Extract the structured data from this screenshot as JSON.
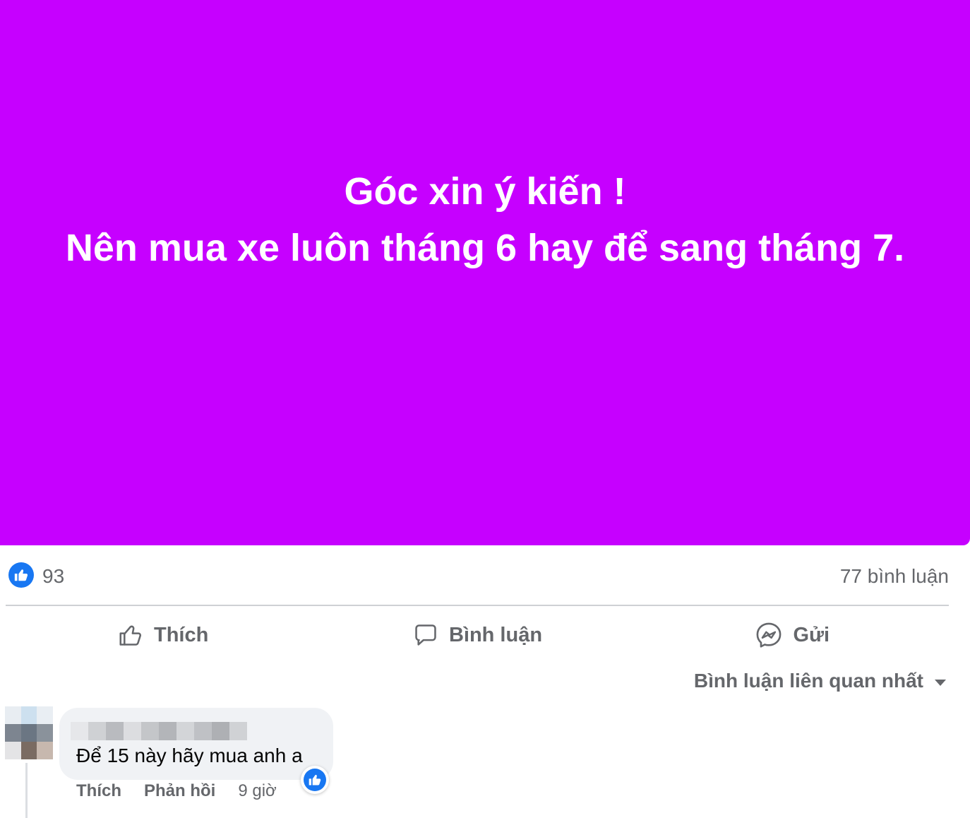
{
  "colors": {
    "banner_bg": "#c600ff",
    "like_blue": "#1877f2",
    "secondary_text": "#65676b"
  },
  "post": {
    "headline": "Góc xin ý kiến !",
    "body": "Nên mua xe luôn tháng 6 hay để sang tháng 7."
  },
  "stats": {
    "likes": "93",
    "comments": "77 bình luận"
  },
  "actions": {
    "like": "Thích",
    "comment": "Bình luận",
    "send": "Gửi"
  },
  "sort": {
    "selected": "Bình luận liên quan nhất"
  },
  "comment": {
    "text": "Để 15 này hãy mua anh a",
    "like": "Thích",
    "reply": "Phản hồi",
    "time": "9 giờ"
  }
}
